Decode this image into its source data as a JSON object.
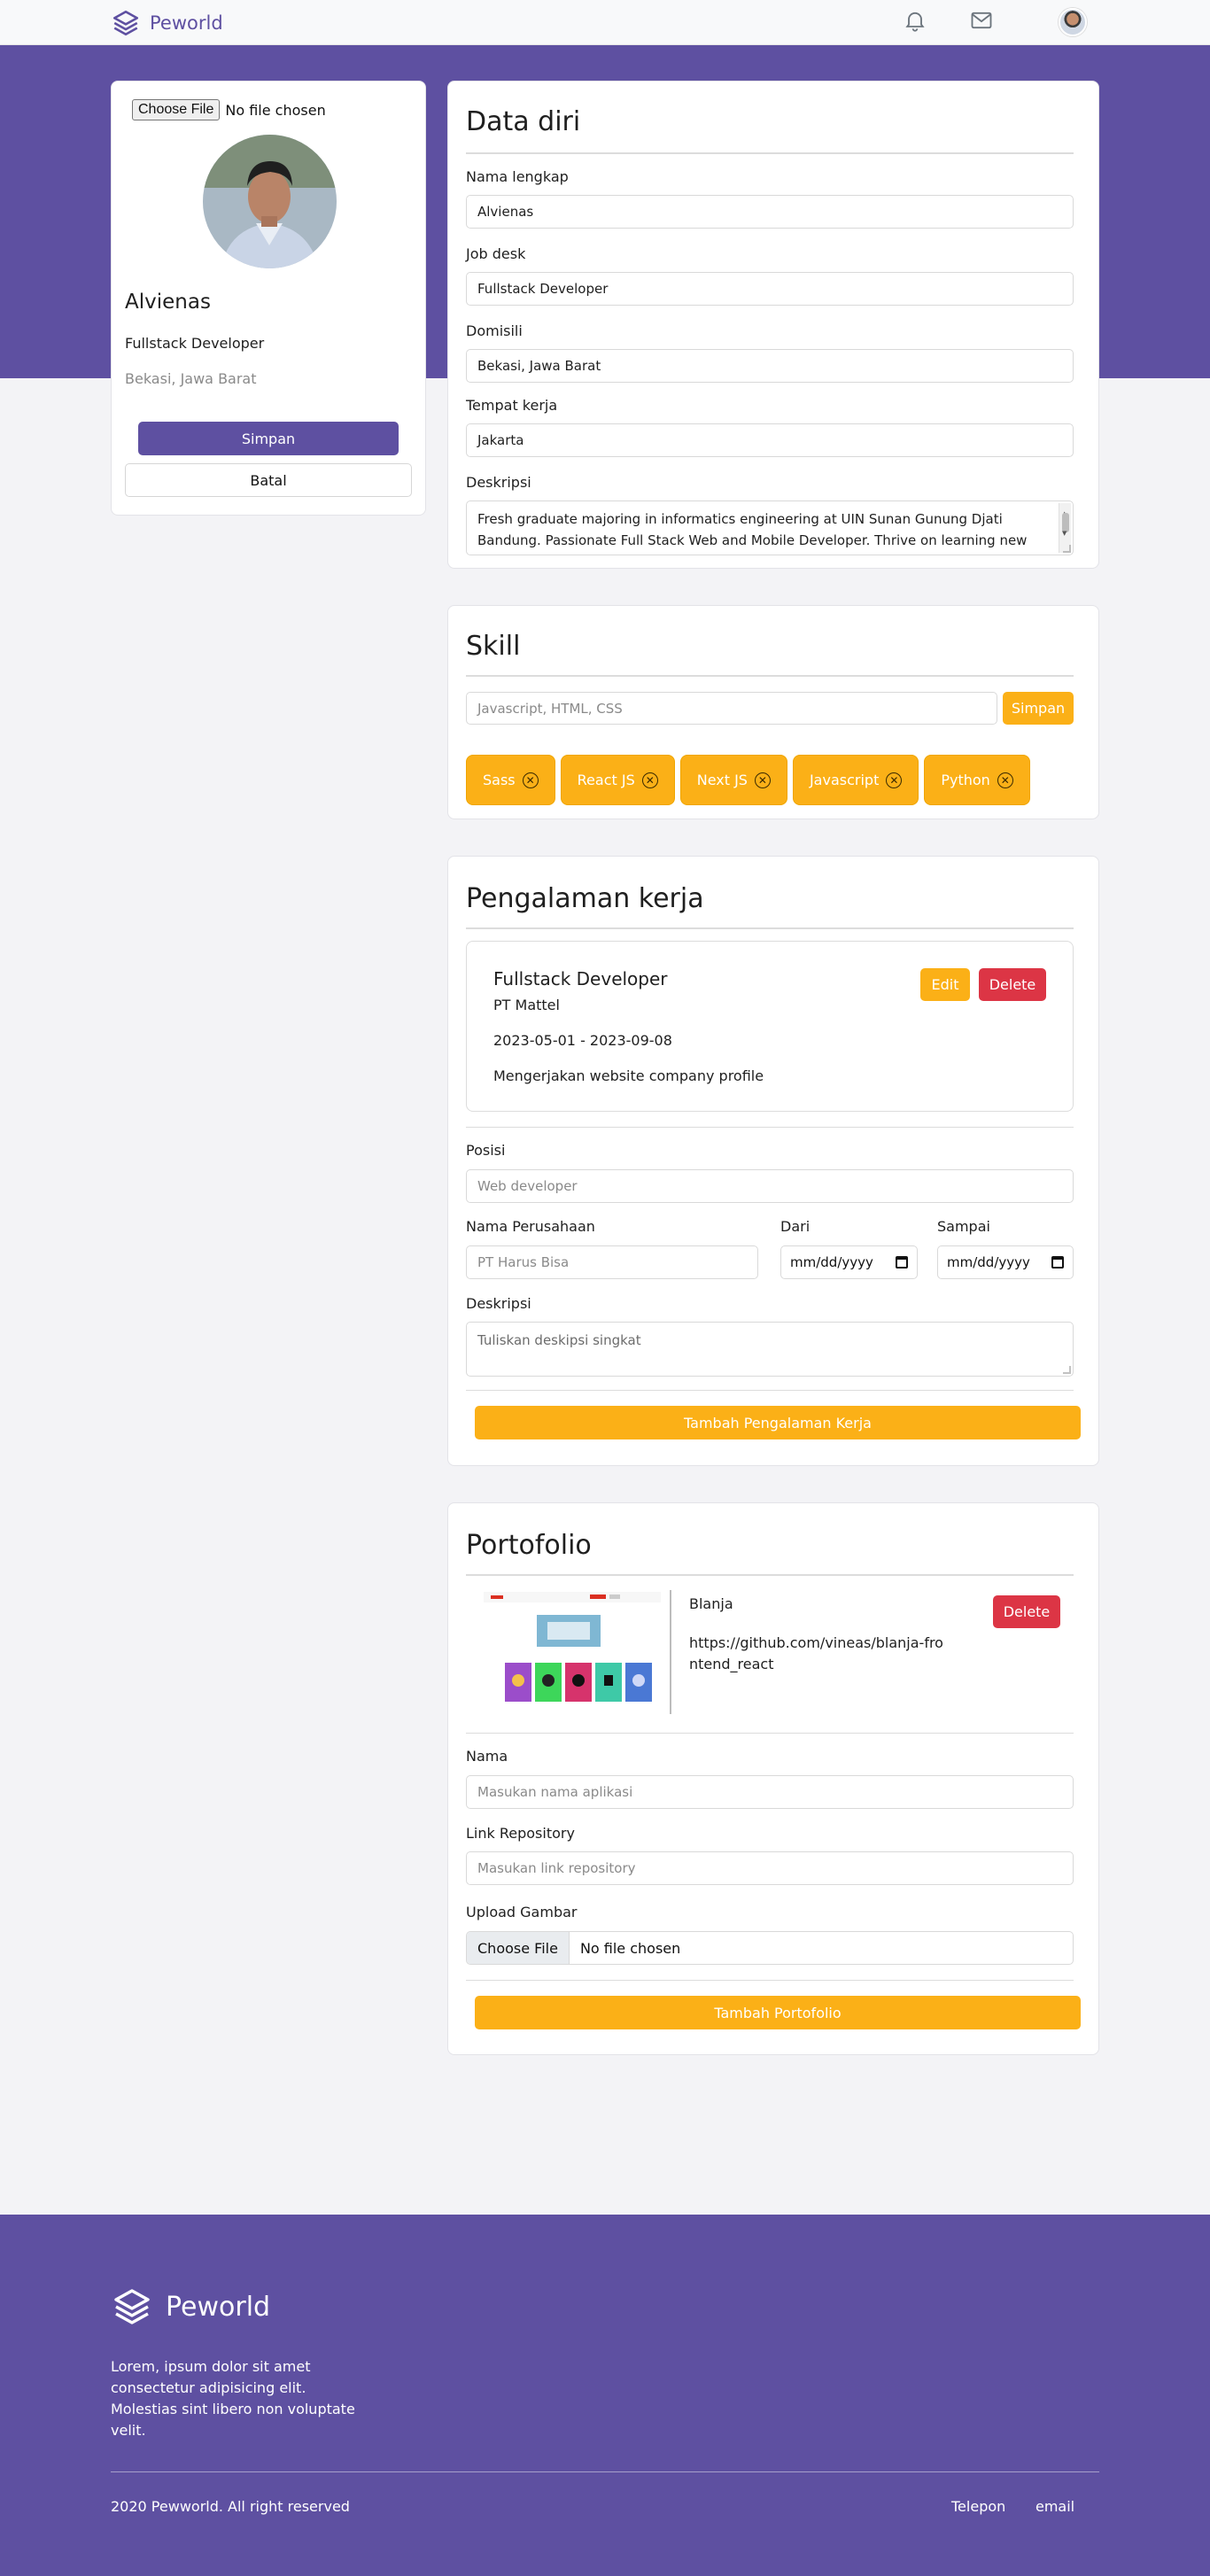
{
  "brand": "Peworld",
  "colors": {
    "primary": "#5e50a1",
    "accent": "#fbb017",
    "danger": "#dc3545"
  },
  "nav": {
    "icons": [
      "bell-icon",
      "mail-icon"
    ]
  },
  "profile": {
    "file_button": "Choose File",
    "file_status": "No file chosen",
    "name": "Alvienas",
    "job": "Fullstack Developer",
    "location": "Bekasi, Jawa Barat",
    "save_label": "Simpan",
    "cancel_label": "Batal"
  },
  "data_diri": {
    "title": "Data diri",
    "fields": [
      {
        "label": "Nama lengkap",
        "value": "Alvienas"
      },
      {
        "label": "Job desk",
        "value": "Fullstack Developer"
      },
      {
        "label": "Domisili",
        "value": "Bekasi, Jawa Barat"
      },
      {
        "label": "Tempat kerja",
        "value": "Jakarta"
      }
    ],
    "desc_label": "Deskripsi",
    "desc_value": "Fresh graduate majoring in informatics engineering at UIN Sunan Gunung Djati Bandung. Passionate Full Stack Web and Mobile Developer. Thrive on learning new things, collaborating with teams, and staying up-to-date with the latest technologies."
  },
  "skill": {
    "title": "Skill",
    "input_placeholder": "Javascript, HTML, CSS",
    "save_label": "Simpan",
    "items": [
      "Sass",
      "React JS",
      "Next JS",
      "Javascript",
      "Python"
    ]
  },
  "experience": {
    "title": "Pengalaman kerja",
    "item": {
      "position": "Fullstack Developer",
      "company": "PT Mattel",
      "period": "2023-05-01 - 2023-09-08",
      "description": "Mengerjakan website company profile",
      "edit_label": "Edit",
      "delete_label": "Delete"
    },
    "form": {
      "position_label": "Posisi",
      "position_placeholder": "Web developer",
      "company_label": "Nama Perusahaan",
      "company_placeholder": "PT Harus Bisa",
      "from_label": "Dari",
      "to_label": "Sampai",
      "date_placeholder": "mm/dd/yyyy",
      "desc_label": "Deskripsi",
      "desc_placeholder": "Tuliskan deskipsi singkat",
      "submit_label": "Tambah Pengalaman Kerja"
    }
  },
  "portfolio": {
    "title": "Portofolio",
    "item": {
      "name": "Blanja",
      "link": "https://github.com/vineas/blanja-frontend_react",
      "delete_label": "Delete"
    },
    "form": {
      "name_label": "Nama",
      "name_placeholder": "Masukan nama aplikasi",
      "link_label": "Link Repository",
      "link_placeholder": "Masukan link repository",
      "upload_label": "Upload Gambar",
      "file_button": "Choose File",
      "file_status": "No file chosen",
      "submit_label": "Tambah Portofolio"
    }
  },
  "footer": {
    "brand": "Peworld",
    "description": "Lorem, ipsum dolor sit amet consectetur adipisicing elit. Molestias sint libero non voluptate velit.",
    "copyright": "2020 Pewworld. All right reserved",
    "links": [
      "Telepon",
      "email"
    ]
  }
}
